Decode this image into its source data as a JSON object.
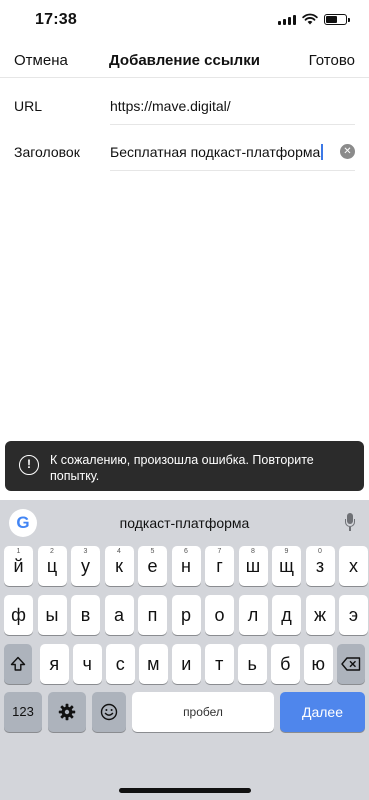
{
  "status_bar": {
    "time": "17:38"
  },
  "navbar": {
    "cancel": "Отмена",
    "title": "Добавление ссылки",
    "done": "Готово"
  },
  "form": {
    "url_label": "URL",
    "url_value": "https://mave.digital/",
    "title_label": "Заголовок",
    "title_value": "Бесплатная подкаст-платформа"
  },
  "toast": {
    "icon": "alert-circle",
    "message": "К сожалению, произошла ошибка. Повторите попытку."
  },
  "keyboard": {
    "suggestion": "подкаст-платформа",
    "row1": [
      {
        "label": "й",
        "hint": "1"
      },
      {
        "label": "ц",
        "hint": "2"
      },
      {
        "label": "у",
        "hint": "3"
      },
      {
        "label": "к",
        "hint": "4"
      },
      {
        "label": "е",
        "hint": "5"
      },
      {
        "label": "н",
        "hint": "6"
      },
      {
        "label": "г",
        "hint": "7"
      },
      {
        "label": "ш",
        "hint": "8"
      },
      {
        "label": "щ",
        "hint": "9"
      },
      {
        "label": "з",
        "hint": "0"
      },
      {
        "label": "х",
        "hint": ""
      }
    ],
    "row2": [
      "ф",
      "ы",
      "в",
      "а",
      "п",
      "р",
      "о",
      "л",
      "д",
      "ж",
      "э"
    ],
    "row3": [
      "я",
      "ч",
      "с",
      "м",
      "и",
      "т",
      "ь",
      "б",
      "ю"
    ],
    "numbers_key": "123",
    "space_key": "пробел",
    "done_key": "Далее"
  }
}
